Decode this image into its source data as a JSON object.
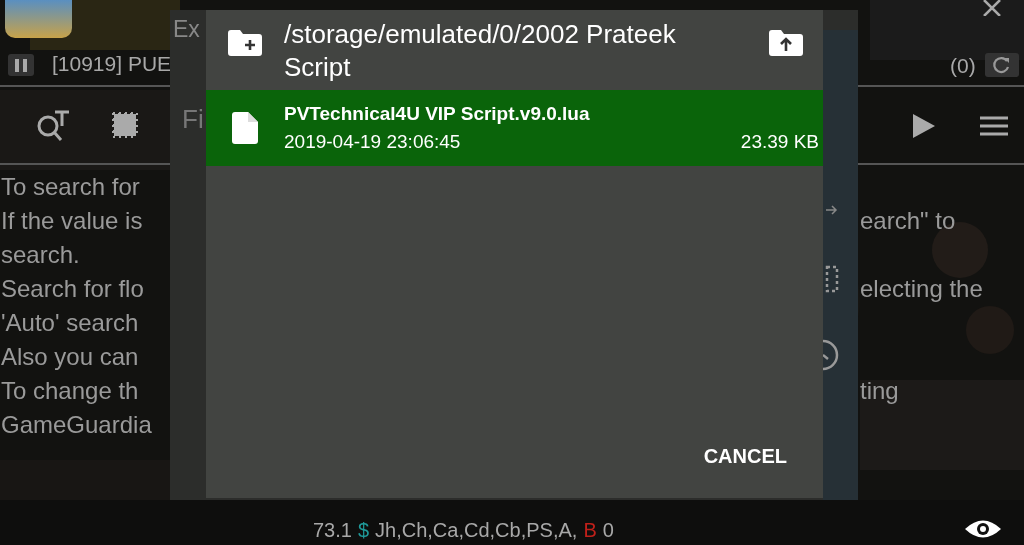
{
  "process_bar": {
    "process": "[10919] PUE",
    "found_count": "(0)"
  },
  "help_text_left": [
    "To search for",
    "If the value is",
    "search.",
    "Search for flo",
    "'Auto' search",
    "Also you can",
    "To change th",
    "GameGuardia"
  ],
  "help_text_right": [
    "earch\" to",
    "electing the",
    "ting"
  ],
  "background_dialog": {
    "title": "Ex",
    "label": "Fi"
  },
  "file_dialog": {
    "path": "/storage/emulated/0/2002 Prateek Script",
    "files": [
      {
        "name": "PVTechnical4U VIP Script.v9.0.lua",
        "date": "2019-04-19 23:06:45",
        "size": "23.39 KB",
        "selected": true
      }
    ],
    "cancel": "CANCEL"
  },
  "status_line": [
    {
      "text": "73.1",
      "color": "#a8a8a8"
    },
    {
      "text": "$",
      "color": "#1f9a9a"
    },
    {
      "text": "Jh,Ch,Ca,Cd,Cb,PS,A,",
      "color": "#a8a8a8"
    },
    {
      "text": "B",
      "color": "#c0201a"
    },
    {
      "text": "0",
      "color": "#a8a8a8"
    }
  ]
}
